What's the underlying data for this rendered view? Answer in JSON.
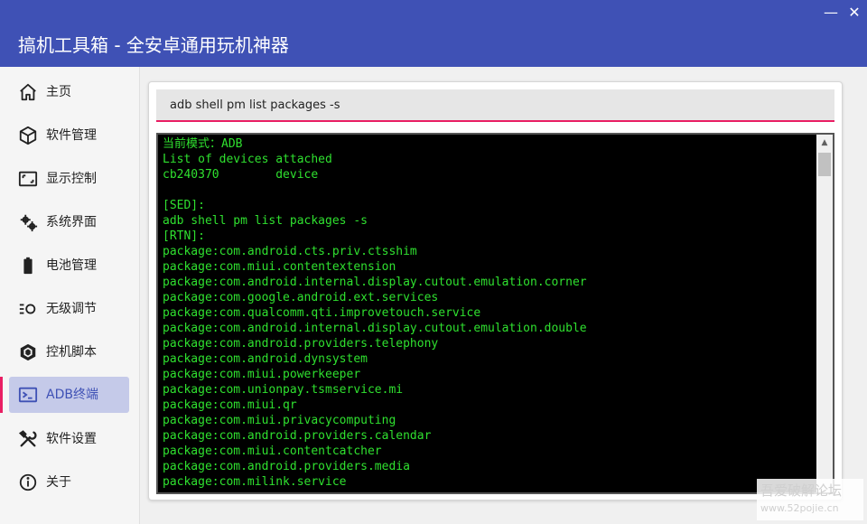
{
  "window": {
    "title": "搞机工具箱 - 全安卓通用玩机神器",
    "minimize_glyph": "—",
    "close_glyph": "✕"
  },
  "sidebar": {
    "items": [
      {
        "label": "主页",
        "icon": "home-icon"
      },
      {
        "label": "软件管理",
        "icon": "package-icon"
      },
      {
        "label": "显示控制",
        "icon": "screen-icon"
      },
      {
        "label": "系统界面",
        "icon": "gears-icon"
      },
      {
        "label": "电池管理",
        "icon": "battery-icon"
      },
      {
        "label": "无级调节",
        "icon": "brightness-icon"
      },
      {
        "label": "控机脚本",
        "icon": "hexagon-icon"
      },
      {
        "label": "ADB终端",
        "icon": "terminal-icon",
        "active": true
      },
      {
        "label": "软件设置",
        "icon": "tools-icon"
      },
      {
        "label": "关于",
        "icon": "info-icon"
      }
    ]
  },
  "command_input": {
    "value": "adb shell pm list packages -s"
  },
  "terminal": {
    "lines": [
      "当前模式：ADB",
      "List of devices attached",
      "cb240370        device",
      "",
      "[SED]:",
      "adb shell pm list packages -s",
      "[RTN]:",
      "package:com.android.cts.priv.ctsshim",
      "package:com.miui.contentextension",
      "package:com.android.internal.display.cutout.emulation.corner",
      "package:com.google.android.ext.services",
      "package:com.qualcomm.qti.improvetouch.service",
      "package:com.android.internal.display.cutout.emulation.double",
      "package:com.android.providers.telephony",
      "package:com.android.dynsystem",
      "package:com.miui.powerkeeper",
      "package:com.unionpay.tsmservice.mi",
      "package:com.miui.qr",
      "package:com.miui.privacycomputing",
      "package:com.android.providers.calendar",
      "package:com.miui.contentcatcher",
      "package:com.android.providers.media",
      "package:com.milink.service"
    ],
    "text_color": "#2fe02f",
    "background": "#000000"
  },
  "colors": {
    "accent": "#3f51b5",
    "active_bg": "#c5cae9",
    "highlight": "#e91e63"
  },
  "watermark": {
    "line1": "吾爱破解论坛",
    "line2": "www.52pojie.cn"
  }
}
